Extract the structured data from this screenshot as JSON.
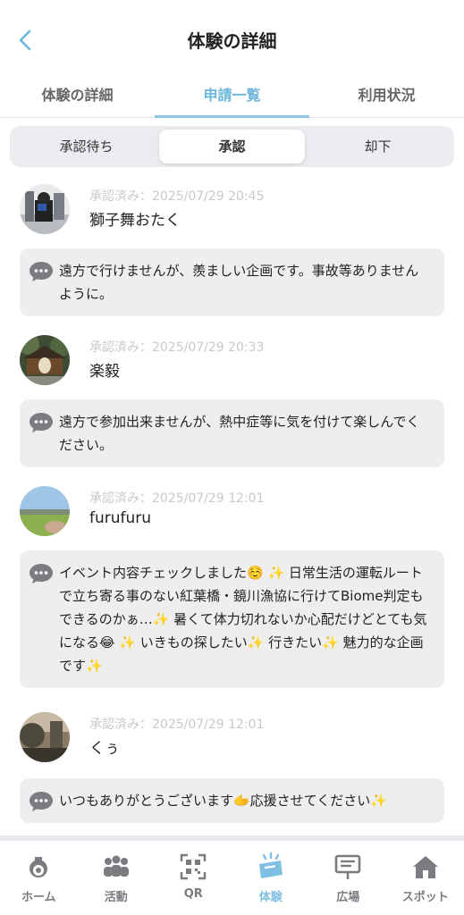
{
  "header": {
    "title": "体験の詳細"
  },
  "tabs": [
    {
      "label": "体験の詳細"
    },
    {
      "label": "申請一覧"
    },
    {
      "label": "利用状況"
    }
  ],
  "segments": [
    {
      "label": "承認待ち"
    },
    {
      "label": "承認"
    },
    {
      "label": "却下"
    }
  ],
  "entries": [
    {
      "status": "承認済み：2025/07/29 20:45",
      "name": "獅子舞おたく",
      "comment": "遠方で行けませんが、羨ましい企画です。事故等ありませんように。"
    },
    {
      "status": "承認済み：2025/07/29 20:33",
      "name": "楽毅",
      "comment": "遠方で参加出来ませんが、熱中症等に気を付けて楽しんでください。"
    },
    {
      "status": "承認済み：2025/07/29 12:01",
      "name": "furufuru",
      "comment": "イベント内容チェックしました☺️ ✨ 日常生活の運転ルートで立ち寄る事のない紅葉橋・鏡川漁協に行けてBiome判定もできるのかぁ…✨ 暑くて体力切れないか心配だけどとても気になる😂 ✨ いきもの探したい✨ 行きたい✨ 魅力的な企画です✨"
    },
    {
      "status": "承認済み：2025/07/29 12:01",
      "name": "くぅ",
      "comment": "いつもありがとうございます🫱応援させてください✨"
    }
  ],
  "nav": [
    {
      "label": "ホーム",
      "icon": "home-icon"
    },
    {
      "label": "活動",
      "icon": "people-icon"
    },
    {
      "label": "QR",
      "icon": "qr-icon"
    },
    {
      "label": "体験",
      "icon": "ticket-icon"
    },
    {
      "label": "広場",
      "icon": "signboard-icon"
    },
    {
      "label": "スポット",
      "icon": "house-icon"
    }
  ],
  "colors": {
    "accent": "#6cb6dc",
    "bubble": "#eeeeef",
    "segment_bg": "#ececf0"
  }
}
